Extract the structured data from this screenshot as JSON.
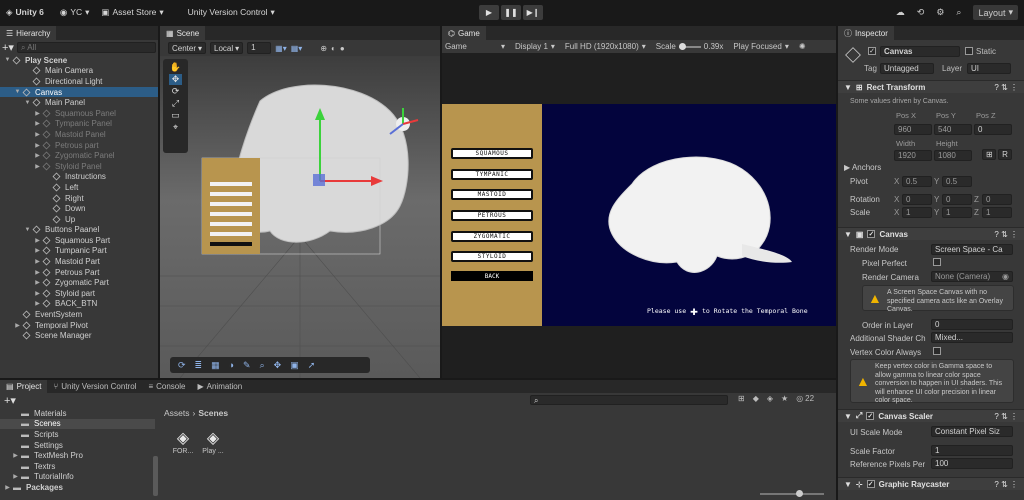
{
  "toolbar": {
    "app": "Unity 6",
    "account": "YC",
    "asset_store": "Asset Store",
    "version_control": "Unity Version Control",
    "layout": "Layout"
  },
  "hierarchy": {
    "tab": "Hierarchy",
    "search_placeholder": "All",
    "items": [
      {
        "label": "Play Scene",
        "indent": 0,
        "arrow": "▼",
        "dim": false,
        "sel": false,
        "scene": true
      },
      {
        "label": "Main Camera",
        "indent": 2,
        "arrow": "",
        "dim": false,
        "sel": false
      },
      {
        "label": "Directional Light",
        "indent": 2,
        "arrow": "",
        "dim": false,
        "sel": false
      },
      {
        "label": "Canvas",
        "indent": 1,
        "arrow": "▼",
        "dim": false,
        "sel": true
      },
      {
        "label": "Main Panel",
        "indent": 2,
        "arrow": "▼",
        "dim": false,
        "sel": false
      },
      {
        "label": "Squamous Panel",
        "indent": 3,
        "arrow": "▶",
        "dim": true,
        "sel": false
      },
      {
        "label": "Tympanic Panel",
        "indent": 3,
        "arrow": "▶",
        "dim": true,
        "sel": false
      },
      {
        "label": "Mastoid Panel",
        "indent": 3,
        "arrow": "▶",
        "dim": true,
        "sel": false
      },
      {
        "label": "Petrous part",
        "indent": 3,
        "arrow": "▶",
        "dim": true,
        "sel": false
      },
      {
        "label": "Zygomatic Panel",
        "indent": 3,
        "arrow": "▶",
        "dim": true,
        "sel": false
      },
      {
        "label": "Styloid Panel",
        "indent": 3,
        "arrow": "▶",
        "dim": true,
        "sel": false
      },
      {
        "label": "Instructions",
        "indent": 4,
        "arrow": "",
        "dim": false,
        "sel": false
      },
      {
        "label": "Left",
        "indent": 4,
        "arrow": "",
        "dim": false,
        "sel": false
      },
      {
        "label": "Right",
        "indent": 4,
        "arrow": "",
        "dim": false,
        "sel": false
      },
      {
        "label": "Down",
        "indent": 4,
        "arrow": "",
        "dim": false,
        "sel": false
      },
      {
        "label": "Up",
        "indent": 4,
        "arrow": "",
        "dim": false,
        "sel": false
      },
      {
        "label": "Buttons Paanel",
        "indent": 2,
        "arrow": "▼",
        "dim": false,
        "sel": false
      },
      {
        "label": "Squamous Part",
        "indent": 3,
        "arrow": "▶",
        "dim": false,
        "sel": false
      },
      {
        "label": "Tumpanic Part",
        "indent": 3,
        "arrow": "▶",
        "dim": false,
        "sel": false
      },
      {
        "label": "Mastoid Part",
        "indent": 3,
        "arrow": "▶",
        "dim": false,
        "sel": false
      },
      {
        "label": "Petrous Part",
        "indent": 3,
        "arrow": "▶",
        "dim": false,
        "sel": false
      },
      {
        "label": "Zygomatic Part",
        "indent": 3,
        "arrow": "▶",
        "dim": false,
        "sel": false
      },
      {
        "label": "Styloid part",
        "indent": 3,
        "arrow": "▶",
        "dim": false,
        "sel": false
      },
      {
        "label": "BACK_BTN",
        "indent": 3,
        "arrow": "▶",
        "dim": false,
        "sel": false
      },
      {
        "label": "EventSystem",
        "indent": 1,
        "arrow": "",
        "dim": false,
        "sel": false
      },
      {
        "label": "Temporal Pivot",
        "indent": 1,
        "arrow": "▶",
        "dim": false,
        "sel": false
      },
      {
        "label": "Scene Manager",
        "indent": 1,
        "arrow": "",
        "dim": false,
        "sel": false
      }
    ]
  },
  "scene": {
    "tab": "Scene",
    "pivot": "Center",
    "space": "Local",
    "snap": "1"
  },
  "game": {
    "tab": "Game",
    "mode": "Game",
    "display": "Display 1",
    "resolution": "Full HD (1920x1080)",
    "scale_label": "Scale",
    "scale_value": "0.39x",
    "play_mode": "Play Focused",
    "buttons": [
      "SQUAMOUS",
      "TYMPANIC",
      "MASTOID",
      "PETROUS",
      "ZYGOMATIC",
      "STYLOID"
    ],
    "back": "BACK",
    "hint_left": "Please use",
    "hint_right": "to Rotate the Temporal Bone"
  },
  "inspector": {
    "tab": "Inspector",
    "object_name": "Canvas",
    "static_label": "Static",
    "tag_label": "Tag",
    "tag_value": "Untagged",
    "layer_label": "Layer",
    "layer_value": "UI",
    "rect": {
      "title": "Rect Transform",
      "note": "Some values driven by Canvas.",
      "posx_l": "Pos X",
      "posy_l": "Pos Y",
      "posz_l": "Pos Z",
      "posx": "960",
      "posy": "540",
      "posz": "0",
      "w_l": "Width",
      "h_l": "Height",
      "w": "1920",
      "h": "1080",
      "btn_r": "R",
      "anchors": "Anchors",
      "pivot": "Pivot",
      "pivot_x": "0.5",
      "pivot_y": "0.5",
      "rotation": "Rotation",
      "rot_x": "0",
      "rot_y": "0",
      "rot_z": "0",
      "scale": "Scale",
      "sc_x": "1",
      "sc_y": "1",
      "sc_z": "1"
    },
    "canvas": {
      "title": "Canvas",
      "render_mode_l": "Render Mode",
      "render_mode": "Screen Space - Ca",
      "pixel_perfect": "Pixel Perfect",
      "render_camera_l": "Render Camera",
      "render_camera": "None (Camera)",
      "warn1": "A Screen Space Canvas with no specified camera acts like an Overlay Canvas.",
      "order_l": "Order in Layer",
      "order": "0",
      "shader_l": "Additional Shader Ch",
      "shader": "Mixed...",
      "vertex_l": "Vertex Color Always",
      "warn2": "Keep vertex color in Gamma space to allow gamma to linear color space conversion to happen in UI shaders. This will enhance UI color precision in linear color space."
    },
    "scaler": {
      "title": "Canvas Scaler",
      "mode_l": "UI Scale Mode",
      "mode": "Constant Pixel Siz",
      "factor_l": "Scale Factor",
      "factor": "1",
      "ref_l": "Reference Pixels Per",
      "ref": "100"
    },
    "raycaster": {
      "title": "Graphic Raycaster"
    }
  },
  "project": {
    "tabs": [
      "Project",
      "Unity Version Control",
      "Console",
      "Animation"
    ],
    "count": "22",
    "tree": [
      {
        "label": "Materials",
        "indent": 1
      },
      {
        "label": "Scenes",
        "indent": 1,
        "sel": true
      },
      {
        "label": "Scripts",
        "indent": 1
      },
      {
        "label": "Settings",
        "indent": 1
      },
      {
        "label": "TextMesh Pro",
        "indent": 1,
        "arrow": "▶"
      },
      {
        "label": "Textrs",
        "indent": 1
      },
      {
        "label": "TutorialInfo",
        "indent": 1,
        "arrow": "▶"
      },
      {
        "label": "Packages",
        "indent": 0,
        "arrow": "▶",
        "bold": true
      }
    ],
    "breadcrumb_root": "Assets",
    "breadcrumb_current": "Scenes",
    "files": [
      {
        "label": "FOR..."
      },
      {
        "label": "Play ..."
      }
    ]
  }
}
